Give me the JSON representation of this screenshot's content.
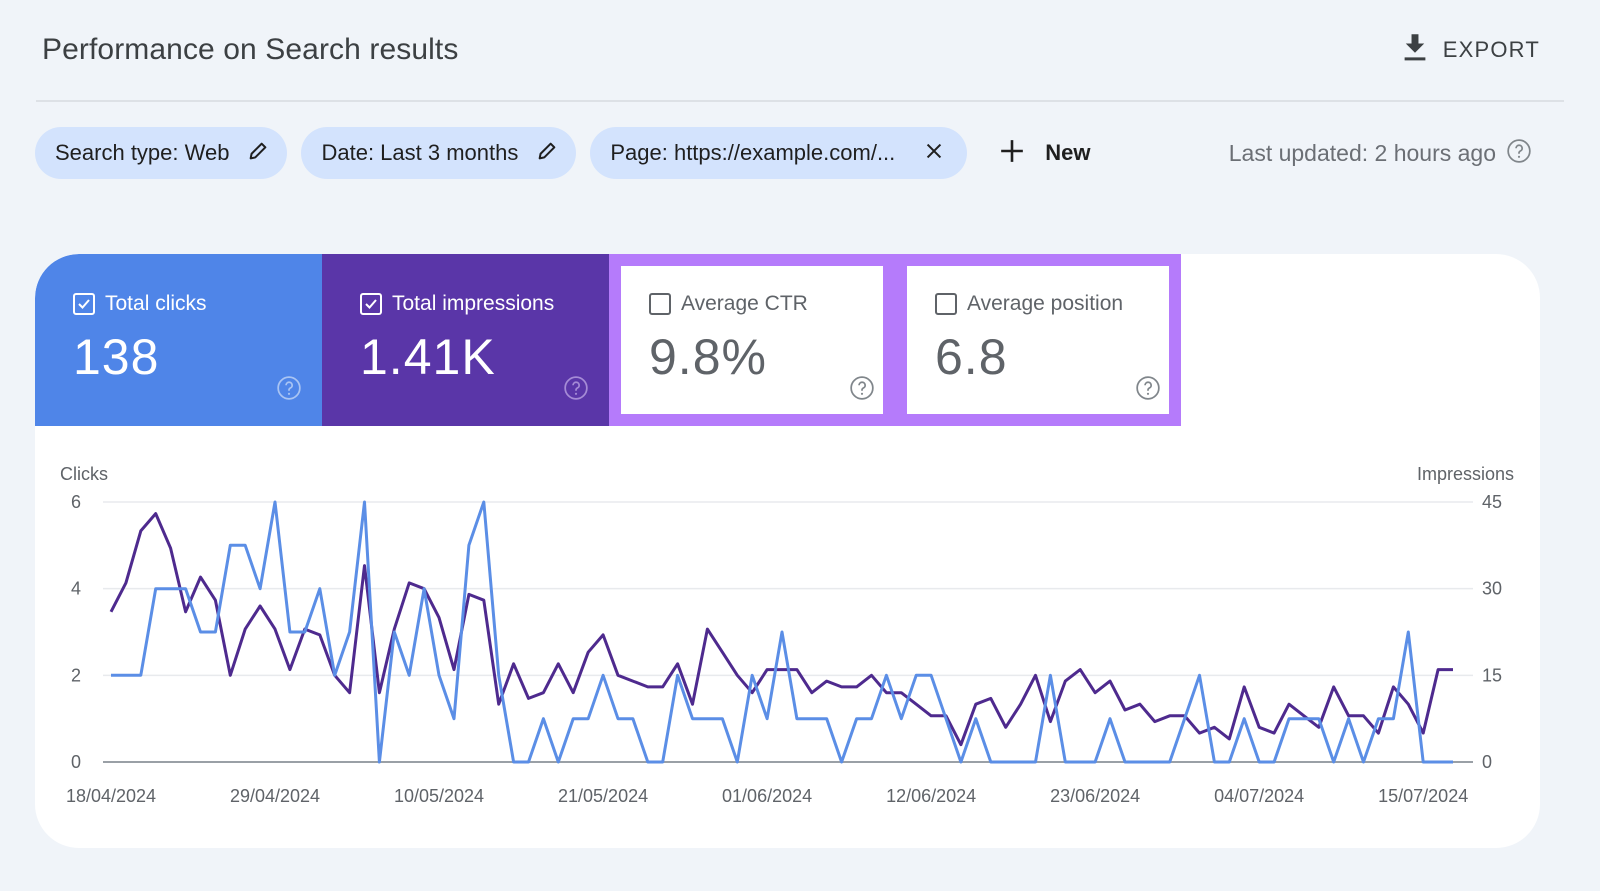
{
  "header": {
    "title": "Performance on Search results",
    "export_label": "EXPORT",
    "export_icon": "download-icon"
  },
  "filters": {
    "chips": [
      {
        "label": "Search type: Web",
        "icon": "pencil-icon"
      },
      {
        "label": "Date: Last 3 months",
        "icon": "pencil-icon"
      },
      {
        "label": "Page: https://example.com/...",
        "icon": "close-icon"
      }
    ],
    "new_label": "New",
    "new_icon": "plus-icon",
    "last_updated": "Last updated: 2 hours ago",
    "help_icon": "help-circle-icon"
  },
  "metrics": [
    {
      "label": "Total clicks",
      "value": "138",
      "checked": true,
      "color": "#4f85e8"
    },
    {
      "label": "Total impressions",
      "value": "1.41K",
      "checked": true,
      "color": "#5a36a8"
    },
    {
      "label": "Average CTR",
      "value": "9.8%",
      "checked": false,
      "highlight": "#b57bfb"
    },
    {
      "label": "Average position",
      "value": "6.8",
      "checked": false,
      "highlight": "#b57bfb"
    }
  ],
  "chart_data": {
    "type": "line",
    "title": "",
    "xlabel": "",
    "ylabel_left": "Clicks",
    "ylabel_right": "Impressions",
    "ylim_left": [
      0,
      6
    ],
    "ylim_right": [
      0,
      45
    ],
    "yticks_left": [
      "0",
      "2",
      "4",
      "6"
    ],
    "yticks_right": [
      "0",
      "15",
      "30",
      "45"
    ],
    "grid": true,
    "x_start": "18/04/2024",
    "x_ticks": [
      "18/04/2024",
      "29/04/2024",
      "10/05/2024",
      "21/05/2024",
      "01/06/2024",
      "12/06/2024",
      "23/06/2024",
      "04/07/2024",
      "15/07/2024"
    ],
    "x_tick_interval_days": 11,
    "series": [
      {
        "name": "Clicks",
        "axis": "left",
        "color": "#5b8ee6",
        "values": [
          2,
          2,
          2,
          4,
          4,
          4,
          3,
          3,
          5,
          5,
          4,
          6,
          3,
          3,
          4,
          2,
          3,
          6,
          0,
          3,
          2,
          4,
          2,
          1,
          5,
          6,
          2,
          0,
          0,
          1,
          0,
          1,
          1,
          2,
          1,
          1,
          0,
          0,
          2,
          1,
          1,
          1,
          0,
          2,
          1,
          3,
          1,
          1,
          1,
          0,
          1,
          1,
          2,
          1,
          2,
          2,
          1,
          0,
          1,
          0,
          0,
          0,
          0,
          2,
          0,
          0,
          0,
          1,
          0,
          0,
          0,
          0,
          1,
          2,
          0,
          0,
          1,
          0,
          0,
          1,
          1,
          1,
          0,
          1,
          0,
          1,
          1,
          3,
          0,
          0,
          0
        ]
      },
      {
        "name": "Impressions",
        "axis": "right",
        "color": "#4e2a8e",
        "values": [
          26,
          31,
          40,
          43,
          37,
          26,
          32,
          28,
          15,
          23,
          27,
          23,
          16,
          23,
          22,
          15,
          12,
          34,
          12,
          23,
          31,
          30,
          25,
          16,
          29,
          28,
          10,
          17,
          11,
          12,
          17,
          12,
          19,
          22,
          15,
          14,
          13,
          13,
          17,
          10,
          23,
          19,
          15,
          12,
          16,
          16,
          16,
          12,
          14,
          13,
          13,
          15,
          12,
          12,
          10,
          8,
          8,
          3,
          10,
          11,
          6,
          10,
          15,
          7,
          14,
          16,
          12,
          14,
          9,
          10,
          7,
          8,
          8,
          5,
          6,
          4,
          13,
          6,
          5,
          10,
          8,
          6,
          13,
          8,
          8,
          5,
          13,
          10,
          5,
          16,
          16
        ]
      }
    ]
  }
}
